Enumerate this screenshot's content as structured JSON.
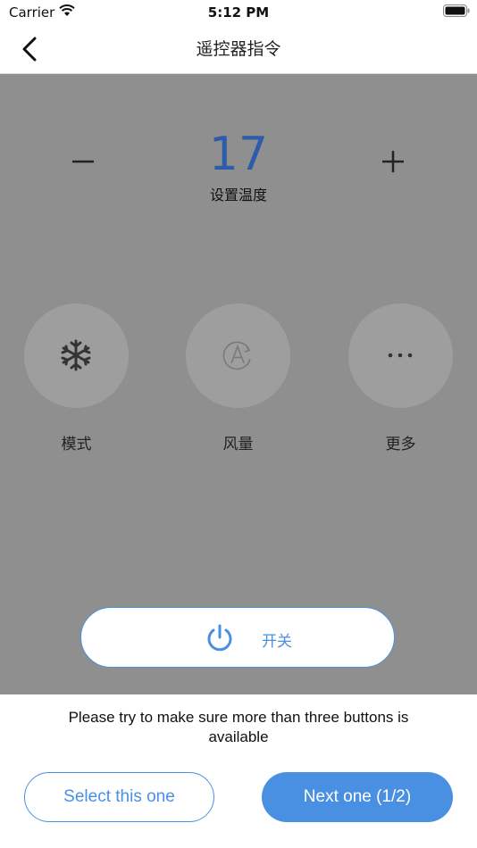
{
  "status_bar": {
    "carrier": "Carrier",
    "time": "5:12 PM"
  },
  "nav": {
    "title": "遥控器指令"
  },
  "remote": {
    "temperature": "17",
    "temperature_label": "设置温度",
    "functions": [
      {
        "label": "模式",
        "icon": "snowflake-icon"
      },
      {
        "label": "风量",
        "icon": "fan-auto-icon"
      },
      {
        "label": "更多",
        "icon": "more-icon"
      }
    ],
    "power_label": "开关"
  },
  "footer": {
    "hint": "Please try to make sure more than three buttons is available",
    "select_label": "Select this one",
    "next_label": "Next one (1/2)"
  },
  "colors": {
    "accent": "#4a90e2",
    "temperature": "#2e5cab",
    "panel_background": "#8f8f8f"
  }
}
